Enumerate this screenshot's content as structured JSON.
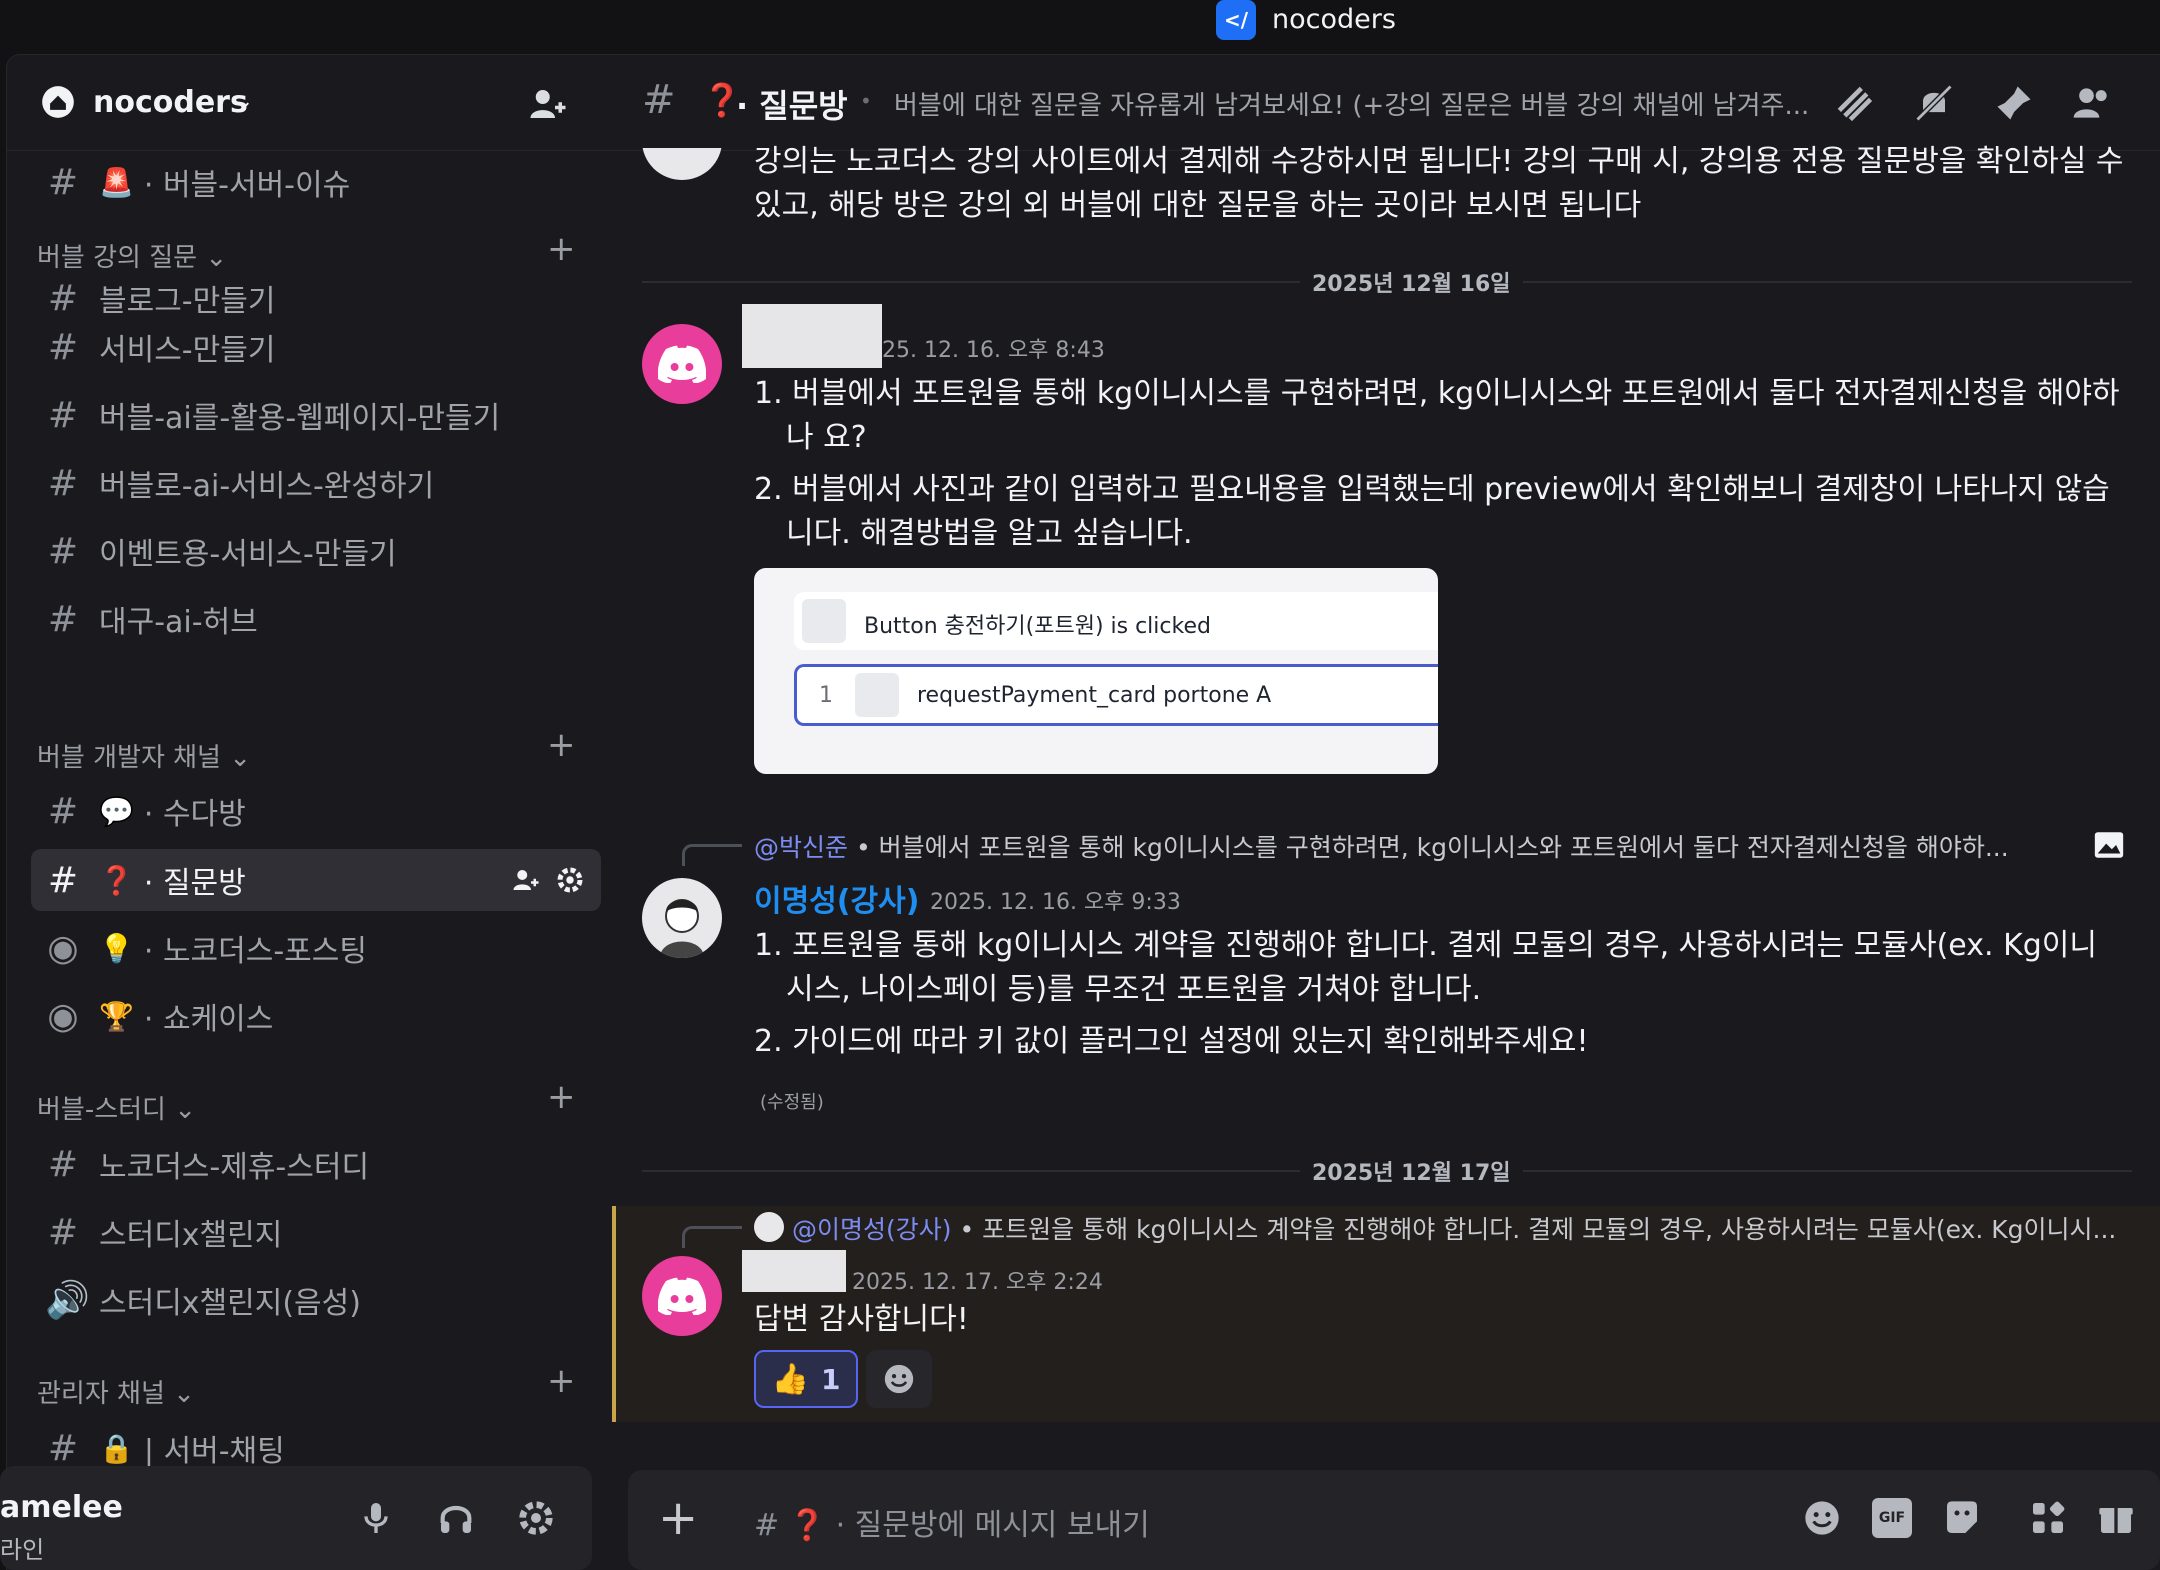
{
  "window": {
    "title": "nocoders",
    "logo_glyph": "</"
  },
  "server": {
    "name": "nocoders",
    "chevron": "⌄"
  },
  "sidebar": {
    "top_channel": {
      "emoji": "🚨",
      "label": "· 버블-서버-이슈"
    },
    "categories": [
      {
        "label": "버블 강의 질문 ⌄",
        "channels": [
          "블로그-만들기",
          "서비스-만들기",
          "버블-ai를-활용-웹페이지-만들기",
          "버블로-ai-서비스-완성하기",
          "이벤트용-서비스-만들기",
          "대구-ai-허브"
        ]
      },
      {
        "label": "버블 개발자 채널 ⌄",
        "channels": [
          {
            "emoji": "💬",
            "label": "· 수다방"
          },
          {
            "emoji": "❓",
            "label": "· 질문방",
            "active": true
          },
          {
            "emoji": "💡",
            "label": "· 노코더스-포스팅"
          },
          {
            "emoji": "🏆",
            "label": "· 쇼케이스"
          }
        ]
      },
      {
        "label": "버블-스터디 ⌄",
        "channels": [
          "노코더스-제휴-스터디",
          "스터디x챌린지",
          "스터디x챌린지(음성)"
        ]
      },
      {
        "label": "관리자 채널 ⌄",
        "channels": [
          {
            "emoji": "🔒",
            "label": "| 서버-채팅"
          }
        ]
      }
    ],
    "plus": "+"
  },
  "user": {
    "name": "amelee",
    "status": "라인"
  },
  "header": {
    "hash": "#",
    "emoji": "❓",
    "channel": "· 질문방",
    "sep": "•",
    "topic": "버블에 대한 질문을 자유롭게 남겨보세요! (+강의 질문은 버블 강의 채널에 남겨주..."
  },
  "messages": {
    "prev_text": "강의는 노코더스 강의 사이트에서 결제해 수강하시면 됩니다! 강의 구매 시, 강의용 전용 질문방을 확인하실 수 있고, 해당 방은 강의 외 버블에 대한 질문을 하는 곳이라 보시면 됩니다",
    "date1": "2025년 12월 16일",
    "m1": {
      "timestamp": "25. 12. 16. 오후 8:43",
      "items": [
        "1. 버블에서 포트원을 통해 kg이니시스를 구현하려면, kg이니시스와 포트원에서 둘다 전자결제신청을 해야하나 요?",
        "2. 버블에서 사진과 같이 입력하고 필요내용을 입력했는데 preview에서 확인해보니 결제창이 나타나지 않습니다. 해결방법을 알고 싶습니다."
      ],
      "embed": {
        "row1": "Button 충전하기(포트원) is clicked",
        "row2_num": "1",
        "row2": "requestPayment_card portone A"
      }
    },
    "m2": {
      "reply_author": "@박신준",
      "reply_text": " • 버블에서 포트원을 통해 kg이니시스를 구현하려면, kg이니시스와 포트원에서 둘다 전자결제신청을 해야하...",
      "author": "이명성(강사)",
      "timestamp": "2025. 12. 16. 오후 9:33",
      "items": [
        "1. 포트원을 통해 kg이니시스 계약을 진행해야 합니다. 결제 모듈의 경우, 사용하시려는 모듈사(ex. Kg이니시스, 나이스페이 등)를 무조건 포트원을 거쳐야 합니다.",
        "2. 가이드에 따라 키 값이 플러그인 설정에 있는지 확인해봐주세요!"
      ],
      "edited": "(수정됨)"
    },
    "date2": "2025년 12월 17일",
    "m3": {
      "reply_author": "@이명성(강사)",
      "reply_text": " • 포트원을 통해 kg이니시스 계약을 진행해야 합니다. 결제 모듈의 경우, 사용하시려는 모듈사(ex. Kg이니시...",
      "timestamp": "2025. 12. 17. 오후 2:24",
      "text": "답변 감사합니다!",
      "reaction_emoji": "👍",
      "reaction_count": "1"
    }
  },
  "composer": {
    "plus": "+",
    "hash": "#",
    "emoji": "❓",
    "placeholder": "· 질문방에 메시지 보내기",
    "gif": "GIF"
  },
  "colors": {
    "accent": "#5865f2",
    "discord_pink": "#e93d9b",
    "mention": "#7d8cf0",
    "highlight_bar": "#c9a44a"
  }
}
